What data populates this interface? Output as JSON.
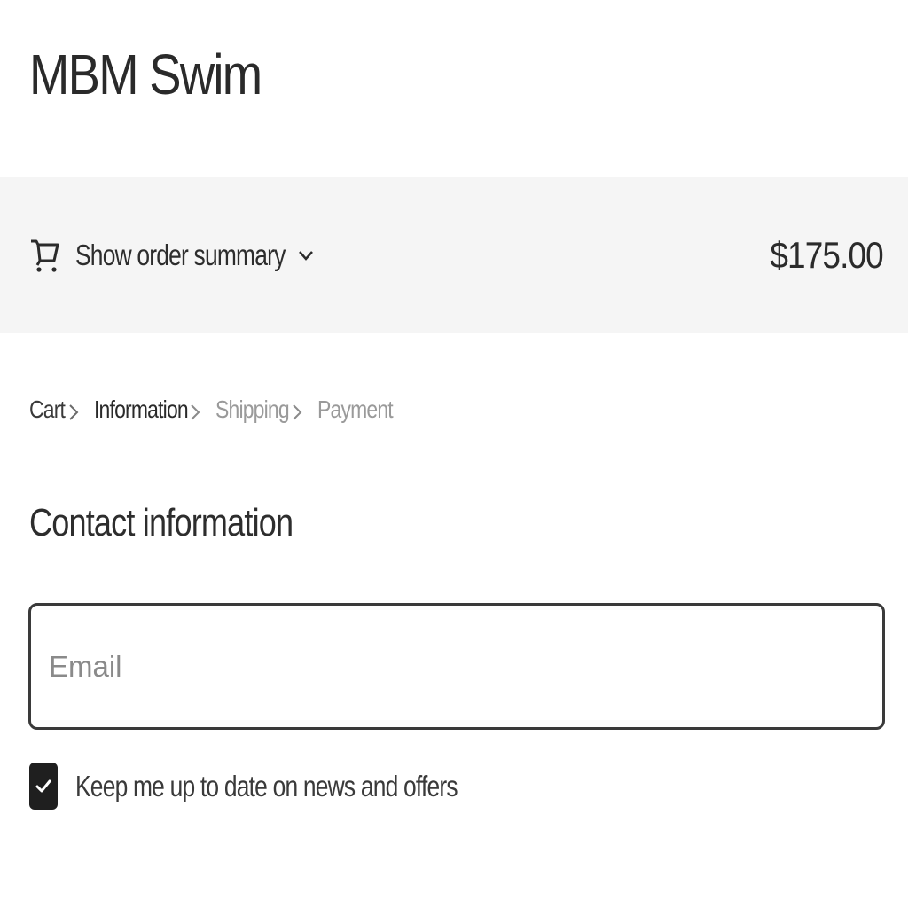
{
  "header": {
    "store_name": "MBM Swim"
  },
  "order_summary": {
    "toggle_label": "Show order summary",
    "toggle_icon": "chevron-down-icon",
    "cart_icon": "cart-icon",
    "total": "$175.00"
  },
  "breadcrumb": {
    "items": [
      {
        "label": "Cart",
        "state": "done"
      },
      {
        "label": "Information",
        "state": "active"
      },
      {
        "label": "Shipping",
        "state": "upcoming"
      },
      {
        "label": "Payment",
        "state": "upcoming"
      }
    ],
    "separator_icon": "chevron-right-icon"
  },
  "contact": {
    "title": "Contact information",
    "email_placeholder": "Email",
    "email_value": "",
    "newsletter_label": "Keep me up to date on news and offers",
    "newsletter_checked": true
  },
  "colors": {
    "summary_bar_bg": "#f5f5f5",
    "text_primary": "#2b2b2b",
    "text_muted": "#9a9a9a",
    "checkbox_fill": "#1f1f1f"
  }
}
